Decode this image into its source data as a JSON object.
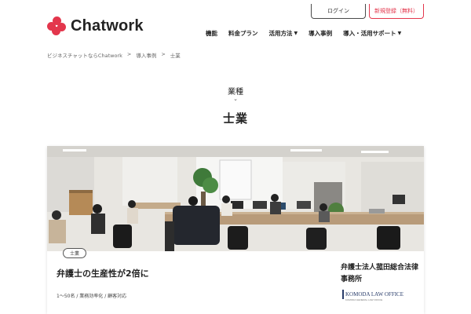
{
  "header": {
    "logo_text": "Chatwork",
    "login_label": "ログイン",
    "signup_label": "新規登録（無料）",
    "nav": [
      {
        "label": "機能",
        "has_dropdown": false
      },
      {
        "label": "料金プラン",
        "has_dropdown": false
      },
      {
        "label": "活用方法",
        "has_dropdown": true
      },
      {
        "label": "導入事例",
        "has_dropdown": false
      },
      {
        "label": "導入・活用サポート",
        "has_dropdown": true
      }
    ],
    "brand_color": "#e3364c"
  },
  "breadcrumb": {
    "items": [
      "ビジネスチャットならChatwork",
      "導入事例",
      "士業"
    ],
    "separator": ">"
  },
  "category": {
    "label": "業種",
    "title": "士業"
  },
  "case": {
    "tag": "士業",
    "title": "弁護士の生産性が2倍に",
    "meta": "1〜50名 / 業務効率化 / 顧客対応",
    "company_name": "弁護士法人菰田総合法律事務所",
    "company_logo_text": "KOMODA LAW OFFICE",
    "company_logo_subtext": "KOMODA GENERAL LAW OFFICE"
  }
}
